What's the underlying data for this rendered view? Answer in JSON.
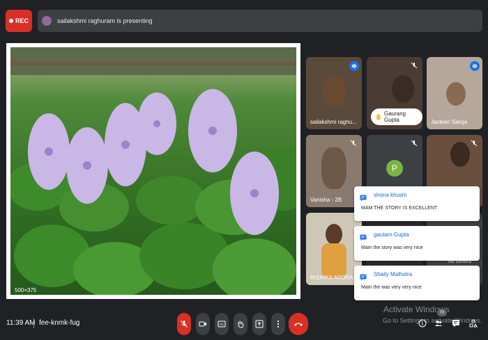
{
  "topbar": {
    "rec_label": "REC",
    "presenting_text": "sailakshmi raghuram is presenting"
  },
  "shared_screen": {
    "size_label": "500×375"
  },
  "participants": [
    {
      "name": "sailakshmi raghu...",
      "mic": "on"
    },
    {
      "name": "Gaurang Gupta",
      "mic": "off"
    },
    {
      "name": "Jasleen Saluja",
      "mic": "on"
    },
    {
      "name": "Vanisha - 2B",
      "mic": "off"
    },
    {
      "name": "",
      "mic": "off",
      "avatar_letter": "P"
    },
    {
      "name": "",
      "mic": "off"
    },
    {
      "name": "RISHIKA ARORA",
      "mic": ""
    },
    {
      "name": "",
      "mic": ""
    },
    {
      "name": "",
      "mic": ""
    }
  ],
  "others_label": "60 others",
  "chat_notifications": [
    {
      "from": "shona khushi",
      "message": "MAM THE STORY IS EXCELLENT"
    },
    {
      "from": "gautam Gupta",
      "message": "Mam the story was very nice"
    },
    {
      "from": "Shaily Malhotra",
      "message": "Mam the was very very nice"
    }
  ],
  "watermark": {
    "line1": "Activate Windows",
    "line2": "Go to Settings to activate Windows."
  },
  "bottombar": {
    "time": "11:39 AM",
    "meeting_code": "fee-knmk-fug",
    "participants_count": "70"
  },
  "colors": {
    "background": "#202124",
    "red": "#d93025",
    "blue": "#1a73e8",
    "panel": "#3c4043"
  }
}
